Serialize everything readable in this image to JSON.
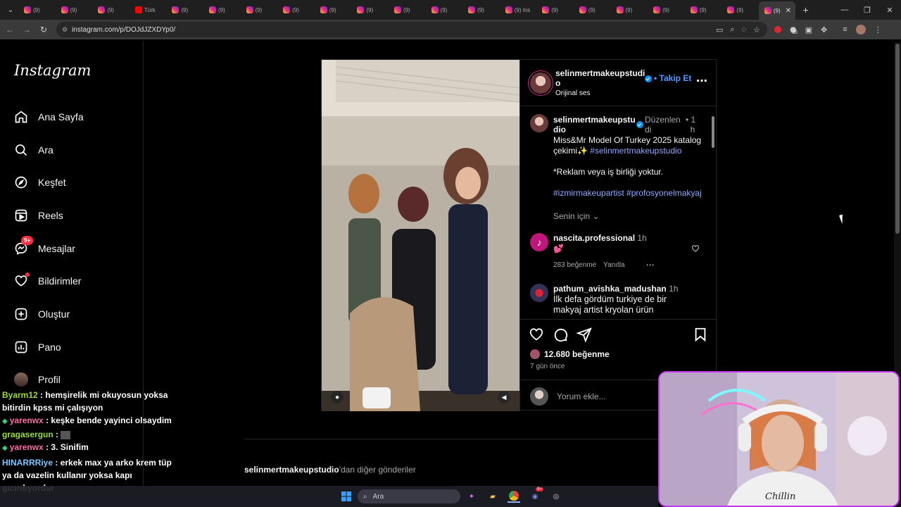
{
  "browser": {
    "active_tab_label": "(9)",
    "yt_tab_label": "Türk",
    "ig_tab_label": "(9)",
    "ig_tab_label_alt": "(9) Ins",
    "url": "instagram.com/p/DOJdJZXDYp0/",
    "ext_badge": "20"
  },
  "nav": {
    "logo": "Instagram",
    "items": [
      {
        "label": "Ana Sayfa"
      },
      {
        "label": "Ara"
      },
      {
        "label": "Keşfet"
      },
      {
        "label": "Reels"
      },
      {
        "label": "Mesajlar"
      },
      {
        "label": "Bildirimler"
      },
      {
        "label": "Oluştur"
      },
      {
        "label": "Pano"
      },
      {
        "label": "Profil"
      }
    ],
    "messages_badge": "9+"
  },
  "post": {
    "author": "selinmertmakeupstudio",
    "author_line1": "selinmertmakeupstudi",
    "author_line2": "o",
    "follow_label": "Takip Et",
    "audio": "Orijinal ses",
    "caption_author_line1": "selinmertmakeupstu",
    "caption_author_line2": "dio",
    "edited_line1": "Düzenlen",
    "edited_line2": "di",
    "caption_time_line1": "1",
    "caption_time_line2": "h",
    "caption_l1": "Miss&Mr Model Of Turkey 2025 katalog",
    "caption_l2": "çekimi✨",
    "caption_tag1": "#selinmertmakeupstudio",
    "caption_l3": "*Reklam veya iş birliği yoktur.",
    "caption_tags": "#izmirmakeupartist #profosyonelmakyaj",
    "translation": "Senin için",
    "comments": [
      {
        "user": "nascita.professional",
        "time": "1h",
        "text": "💕",
        "likes": "283 beğenme",
        "reply": "Yanıtla"
      },
      {
        "user": "pathum_avishka_madushan",
        "time": "1h",
        "text_l1": "İlk defa gördüm turkiye de bir",
        "text_l2": "makyaj artist kryolan ürün"
      }
    ],
    "likes": "12.680 beğenme",
    "date": "7 gün önce",
    "comment_placeholder": "Yorum ekle..."
  },
  "more_posts": {
    "author": "selinmertmakeupstudio",
    "suffix": "'dan diğer gönderiler"
  },
  "chat": [
    {
      "user": "Byarm12",
      "msg": "hemşirelik mi okuyosun yoksa",
      "cont": "bitirdin kpss mi çalışıyon"
    },
    {
      "user": "yarenwx",
      "msg": "keşke bende yayinci olsaydim"
    },
    {
      "user": "gragasergun",
      "msg": ""
    },
    {
      "user": "yarenwx",
      "msg": "3. Sinifim"
    },
    {
      "user": "HINARRRiye",
      "msg": "erkek max ya arko krem tüp",
      "cont": "ya da vazelin kullanır yoksa kapı",
      "cont2": "gıcırdıyordur"
    }
  ],
  "taskbar": {
    "search_label": "Ara",
    "discord_badge": "9+"
  }
}
